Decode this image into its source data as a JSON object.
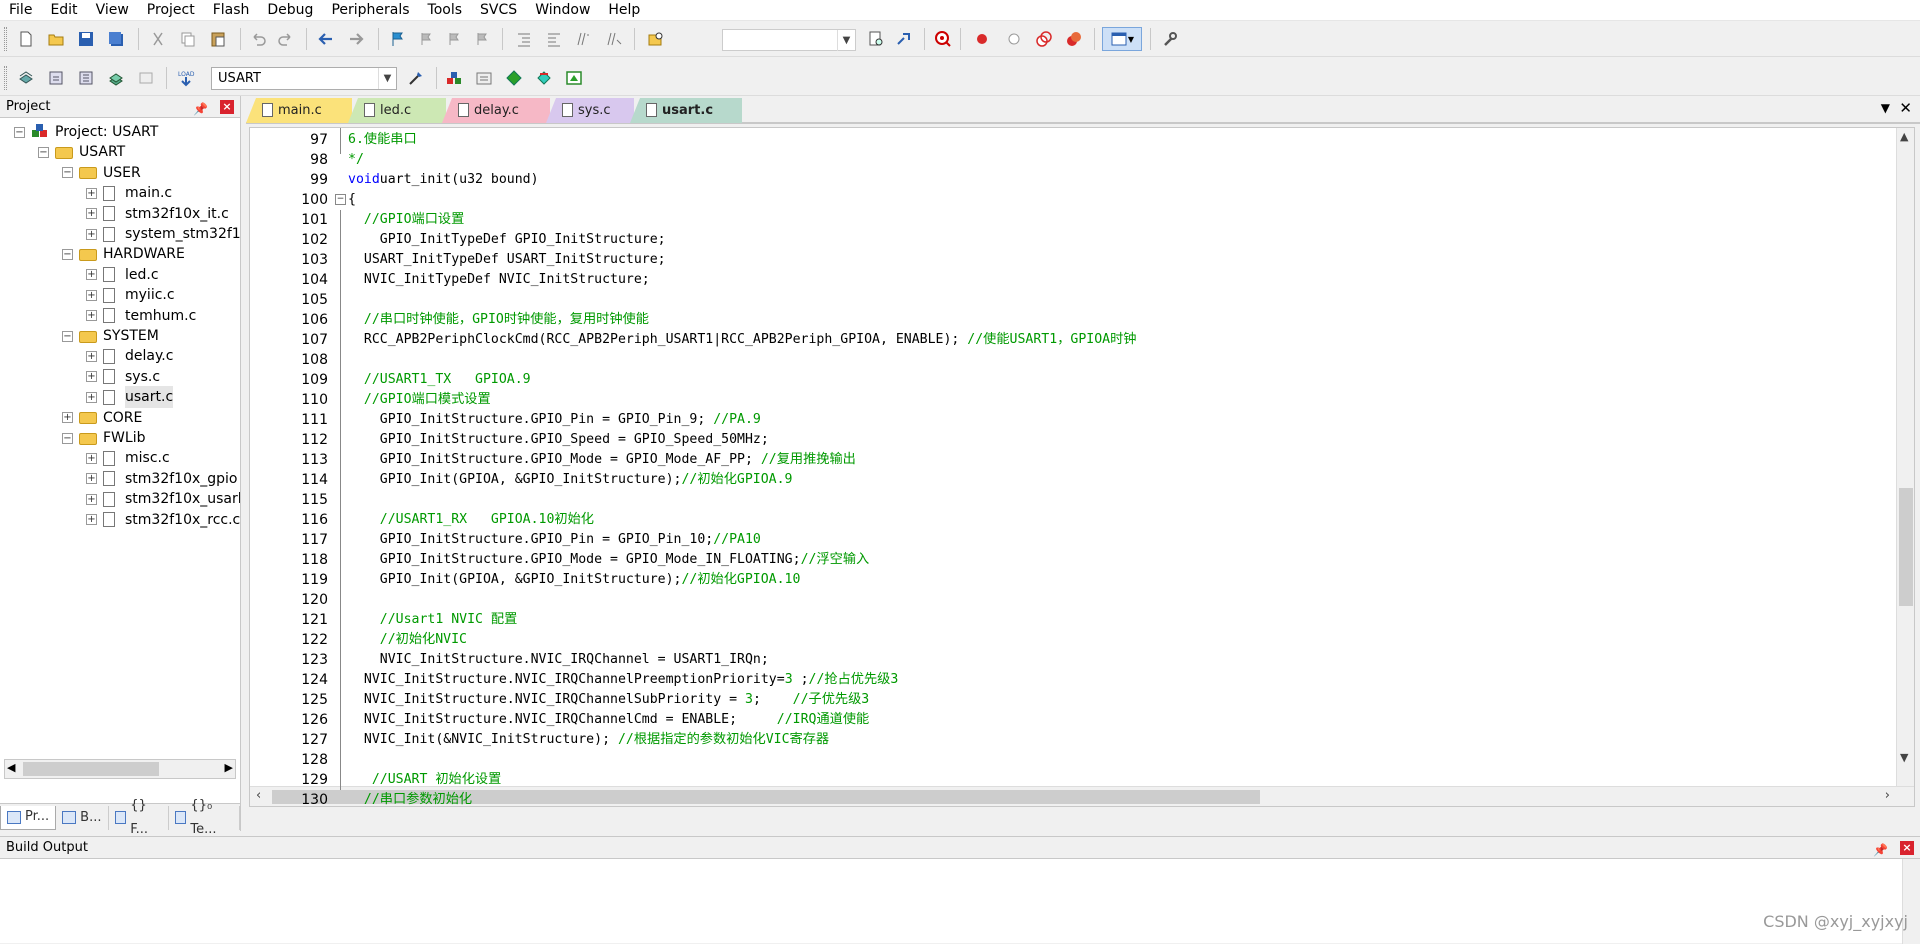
{
  "menu": [
    "File",
    "Edit",
    "View",
    "Project",
    "Flash",
    "Debug",
    "Peripherals",
    "Tools",
    "SVCS",
    "Window",
    "Help"
  ],
  "toolbar2": {
    "target_value": "USART"
  },
  "project_panel": {
    "title": "Project",
    "tree": [
      {
        "label": "Project: USART",
        "level": 0,
        "type": "root",
        "exp": "−"
      },
      {
        "label": "USART",
        "level": 1,
        "type": "target",
        "exp": "−"
      },
      {
        "label": "USER",
        "level": 2,
        "type": "folder",
        "exp": "−"
      },
      {
        "label": "main.c",
        "level": 3,
        "type": "file",
        "exp": "+"
      },
      {
        "label": "stm32f10x_it.c",
        "level": 3,
        "type": "file",
        "exp": "+"
      },
      {
        "label": "system_stm32f1",
        "level": 3,
        "type": "file",
        "exp": "+"
      },
      {
        "label": "HARDWARE",
        "level": 2,
        "type": "folder",
        "exp": "−"
      },
      {
        "label": "led.c",
        "level": 3,
        "type": "file",
        "exp": "+"
      },
      {
        "label": "myiic.c",
        "level": 3,
        "type": "file",
        "exp": "+"
      },
      {
        "label": "temhum.c",
        "level": 3,
        "type": "file",
        "exp": "+"
      },
      {
        "label": "SYSTEM",
        "level": 2,
        "type": "folder",
        "exp": "−"
      },
      {
        "label": "delay.c",
        "level": 3,
        "type": "file",
        "exp": "+"
      },
      {
        "label": "sys.c",
        "level": 3,
        "type": "file",
        "exp": "+"
      },
      {
        "label": "usart.c",
        "level": 3,
        "type": "file",
        "exp": "+",
        "selected": true
      },
      {
        "label": "CORE",
        "level": 2,
        "type": "folder",
        "exp": "+"
      },
      {
        "label": "FWLib",
        "level": 2,
        "type": "folder",
        "exp": "−"
      },
      {
        "label": "misc.c",
        "level": 3,
        "type": "file",
        "exp": "+"
      },
      {
        "label": "stm32f10x_gpio",
        "level": 3,
        "type": "file",
        "exp": "+"
      },
      {
        "label": "stm32f10x_usarl",
        "level": 3,
        "type": "file",
        "exp": "+"
      },
      {
        "label": "stm32f10x_rcc.c",
        "level": 3,
        "type": "file",
        "exp": "+"
      }
    ],
    "bottom_tabs": [
      "Pr...",
      "B...",
      "{} F...",
      "{}₀ Te..."
    ]
  },
  "editor": {
    "tabs": [
      {
        "label": "main.c",
        "color": "#fbe27a"
      },
      {
        "label": "led.c",
        "color": "#cde8b4"
      },
      {
        "label": "delay.c",
        "color": "#f6b8c6"
      },
      {
        "label": "sys.c",
        "color": "#d8c8ee"
      },
      {
        "label": "usart.c",
        "color": "#b7d9cc",
        "active": true
      }
    ],
    "lines": [
      {
        "n": "97",
        "t": [
          [
            "cm",
            "6.使能串口"
          ]
        ]
      },
      {
        "n": "98",
        "t": [
          [
            "cm",
            "*/"
          ]
        ]
      },
      {
        "n": "99",
        "t": [
          [
            "kw",
            "void"
          ],
          [
            "",
            "uart_init(u32 bound)"
          ]
        ]
      },
      {
        "n": "100",
        "t": [
          [
            "",
            "{"
          ]
        ]
      },
      {
        "n": "101",
        "t": [
          [
            "",
            "  "
          ],
          [
            "cm",
            "//GPIO端口设置"
          ]
        ]
      },
      {
        "n": "102",
        "t": [
          [
            "",
            "    GPIO_InitTypeDef GPIO_InitStructure;"
          ]
        ]
      },
      {
        "n": "103",
        "t": [
          [
            "",
            "  USART_InitTypeDef USART_InitStructure;"
          ]
        ]
      },
      {
        "n": "104",
        "t": [
          [
            "",
            "  NVIC_InitTypeDef NVIC_InitStructure;"
          ]
        ]
      },
      {
        "n": "105",
        "t": []
      },
      {
        "n": "106",
        "t": [
          [
            "",
            "  "
          ],
          [
            "cm",
            "//串口时钟使能，GPIO时钟使能，复用时钟使能"
          ]
        ]
      },
      {
        "n": "107",
        "t": [
          [
            "",
            "  RCC_APB2PeriphClockCmd(RCC_APB2Periph_USART1|RCC_APB2Periph_GPIOA, ENABLE); "
          ],
          [
            "cm",
            "//使能USART1，GPIOA时钟"
          ]
        ]
      },
      {
        "n": "108",
        "t": []
      },
      {
        "n": "109",
        "t": [
          [
            "",
            "  "
          ],
          [
            "cm",
            "//USART1_TX   GPIOA.9"
          ]
        ]
      },
      {
        "n": "110",
        "t": [
          [
            "",
            "  "
          ],
          [
            "cm",
            "//GPIO端口模式设置"
          ]
        ]
      },
      {
        "n": "111",
        "t": [
          [
            "",
            "    GPIO_InitStructure.GPIO_Pin = GPIO_Pin_9; "
          ],
          [
            "cm",
            "//PA.9"
          ]
        ]
      },
      {
        "n": "112",
        "t": [
          [
            "",
            "    GPIO_InitStructure.GPIO_Speed = GPIO_Speed_50MHz;"
          ]
        ]
      },
      {
        "n": "113",
        "t": [
          [
            "",
            "    GPIO_InitStructure.GPIO_Mode = GPIO_Mode_AF_PP; "
          ],
          [
            "cm",
            "//复用推挽输出"
          ]
        ]
      },
      {
        "n": "114",
        "t": [
          [
            "",
            "    GPIO_Init(GPIOA, &GPIO_InitStructure);"
          ],
          [
            "cm",
            "//初始化GPIOA.9"
          ]
        ]
      },
      {
        "n": "115",
        "t": []
      },
      {
        "n": "116",
        "t": [
          [
            "",
            "    "
          ],
          [
            "cm",
            "//USART1_RX   GPIOA.10初始化"
          ]
        ]
      },
      {
        "n": "117",
        "t": [
          [
            "",
            "    GPIO_InitStructure.GPIO_Pin = GPIO_Pin_10;"
          ],
          [
            "cm",
            "//PA10"
          ]
        ]
      },
      {
        "n": "118",
        "t": [
          [
            "",
            "    GPIO_InitStructure.GPIO_Mode = GPIO_Mode_IN_FLOATING;"
          ],
          [
            "cm",
            "//浮空输入"
          ]
        ]
      },
      {
        "n": "119",
        "t": [
          [
            "",
            "    GPIO_Init(GPIOA, &GPIO_InitStructure);"
          ],
          [
            "cm",
            "//初始化GPIOA.10"
          ]
        ]
      },
      {
        "n": "120",
        "t": []
      },
      {
        "n": "121",
        "t": [
          [
            "",
            "    "
          ],
          [
            "cm",
            "//Usart1 NVIC 配置"
          ]
        ]
      },
      {
        "n": "122",
        "t": [
          [
            "",
            "    "
          ],
          [
            "cm",
            "//初始化NVIC"
          ]
        ]
      },
      {
        "n": "123",
        "t": [
          [
            "",
            "    NVIC_InitStructure.NVIC_IRQChannel = USART1_IRQn;"
          ]
        ]
      },
      {
        "n": "124",
        "t": [
          [
            "",
            "  NVIC_InitStructure.NVIC_IRQChannelPreemptionPriority="
          ],
          [
            "num",
            "3"
          ],
          [
            "",
            " ;"
          ],
          [
            "cm",
            "//抢占优先级3"
          ]
        ]
      },
      {
        "n": "125",
        "t": [
          [
            "",
            "  NVIC_InitStructure.NVIC_IRQChannelSubPriority = "
          ],
          [
            "num",
            "3"
          ],
          [
            "",
            ";    "
          ],
          [
            "cm",
            "//子优先级3"
          ]
        ]
      },
      {
        "n": "126",
        "t": [
          [
            "",
            "  NVIC_InitStructure.NVIC_IRQChannelCmd = ENABLE;     "
          ],
          [
            "cm",
            "//IRQ通道使能"
          ]
        ]
      },
      {
        "n": "127",
        "t": [
          [
            "",
            "  NVIC_Init(&NVIC_InitStructure); "
          ],
          [
            "cm",
            "//根据指定的参数初始化VIC寄存器"
          ]
        ]
      },
      {
        "n": "128",
        "t": []
      },
      {
        "n": "129",
        "t": [
          [
            "",
            "   "
          ],
          [
            "cm",
            "//USART 初始化设置"
          ]
        ]
      },
      {
        "n": "130",
        "t": [
          [
            "",
            "  "
          ],
          [
            "cm",
            "//串口参数初始化"
          ]
        ]
      }
    ]
  },
  "build_output": {
    "title": "Build Output"
  },
  "watermark": "CSDN @xyj_xyjxyj"
}
